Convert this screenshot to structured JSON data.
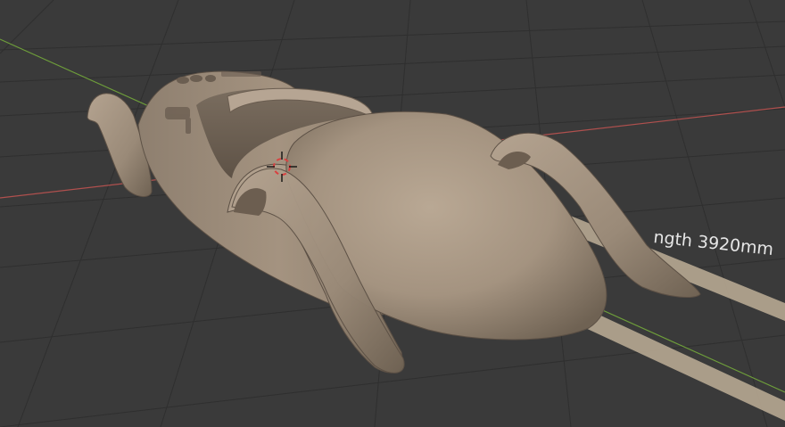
{
  "viewport": {
    "background": "#3a3a3a",
    "grid_color": "#2f2f2f",
    "x_axis_color": "#b0504e",
    "y_axis_color": "#6e9e3a"
  },
  "model": {
    "body_color": "#a49380",
    "shadow_color": "#6c5e50",
    "highlight_color": "#c4b3a0"
  },
  "measurement": {
    "label": "ngth 3920mm",
    "bar_color": "#b7a892"
  },
  "cursor_3d": {
    "icon": "3d-cursor-icon",
    "ring_color": "#d94040"
  }
}
